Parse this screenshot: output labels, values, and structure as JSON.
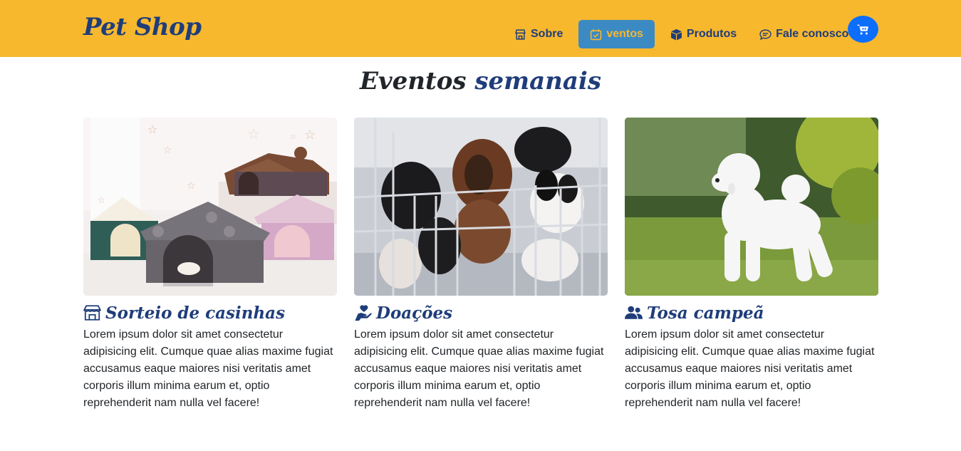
{
  "navbar": {
    "brand": "Pet Shop",
    "items": [
      {
        "label": "Sobre",
        "icon": "store-icon"
      },
      {
        "label": "ventos",
        "icon": "calendar-check-icon",
        "active": true
      },
      {
        "label": "Produtos",
        "icon": "box-icon"
      },
      {
        "label": "Fale conosco",
        "icon": "chat-icon"
      }
    ],
    "cart_icon": "cart-icon"
  },
  "section": {
    "title_part1": "Eventos",
    "title_part2": "semanais"
  },
  "cards": [
    {
      "title": "Sorteio de casinhas",
      "icon": "shop-icon",
      "image": "pet-houses-photo",
      "text": "Lorem ipsum dolor sit amet consectetur adipisicing elit. Cumque quae alias maxime fugiat accusamus eaque maiores nisi veritatis amet corporis illum minima earum et, optio reprehenderit nam nulla vel facere!"
    },
    {
      "title": "Doações",
      "icon": "hand-heart-icon",
      "image": "puppies-photo",
      "text": "Lorem ipsum dolor sit amet consectetur adipisicing elit. Cumque quae alias maxime fugiat accusamus eaque maiores nisi veritatis amet corporis illum minima earum et, optio reprehenderit nam nulla vel facere!"
    },
    {
      "title": "Tosa campeã",
      "icon": "users-icon",
      "image": "poodle-photo",
      "text": "Lorem ipsum dolor sit amet consectetur adipisicing elit. Cumque quae alias maxime fugiat accusamus eaque maiores nisi veritatis amet corporis illum minima earum et, optio reprehenderit nam nulla vel facere!"
    }
  ],
  "colors": {
    "navbar_bg": "#f7b82e",
    "brand_blue": "#1f3d7a",
    "active_tab_bg": "#3b8ac4",
    "cart_button": "#0d6efd"
  }
}
